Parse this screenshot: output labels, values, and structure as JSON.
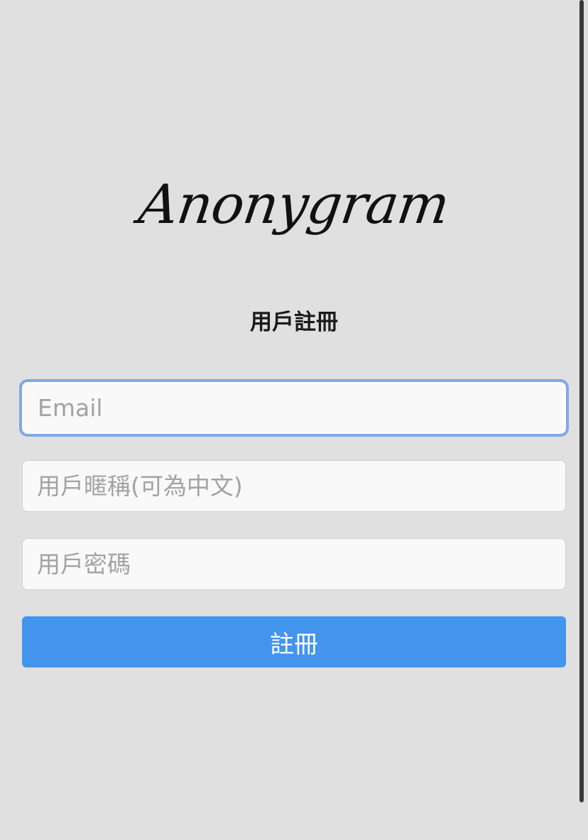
{
  "app": {
    "logo_text": "Anonygram"
  },
  "form": {
    "title": "用戶註冊",
    "email_placeholder": "Email",
    "nickname_placeholder": "用戶暱稱(可為中文)",
    "password_placeholder": "用戶密碼",
    "submit_label": "註冊"
  },
  "colors": {
    "background": "#e0e0e0",
    "primary_button": "#4394ec",
    "focus_ring": "#7fa9e6"
  }
}
